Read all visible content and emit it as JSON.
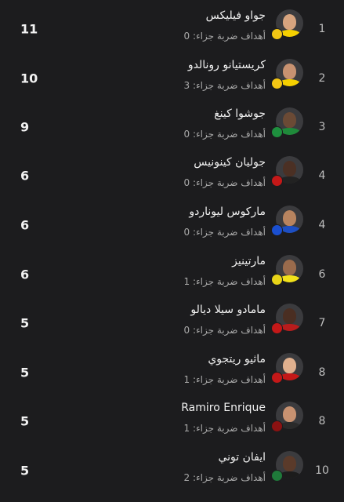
{
  "pen_label": "أهداف ضربة جزاء:",
  "colors": {
    "background": "#1c1c1e",
    "text_primary": "#f0f0f0",
    "text_secondary": "#a9a9a9"
  },
  "players": [
    {
      "rank": "1",
      "name": "جواو فيليكس",
      "penalties": "0",
      "goals": "11",
      "skin": "#d7a47f",
      "shirt": "#f5d000",
      "badge_color": "#f3c614",
      "badge_icon": "club-crest-icon"
    },
    {
      "rank": "2",
      "name": "كريستيانو رونالدو",
      "penalties": "3",
      "goals": "10",
      "skin": "#c89271",
      "shirt": "#f5d000",
      "badge_color": "#f3c614",
      "badge_icon": "club-crest-icon"
    },
    {
      "rank": "3",
      "name": "جوشوا كينغ",
      "penalties": "0",
      "goals": "9",
      "skin": "#6b4a35",
      "shirt": "#1f8a3a",
      "badge_color": "#1e8f3e",
      "badge_icon": "club-crest-icon"
    },
    {
      "rank": "4",
      "name": "جوليان كينونيس",
      "penalties": "0",
      "goals": "6",
      "skin": "#4b3024",
      "shirt": "#222222",
      "badge_color": "#c41818",
      "badge_icon": "club-crest-icon"
    },
    {
      "rank": "4",
      "name": "ماركوس ليوناردو",
      "penalties": "0",
      "goals": "6",
      "skin": "#b8845f",
      "shirt": "#1d4fc4",
      "badge_color": "#1a4fd0",
      "badge_icon": "club-crest-icon"
    },
    {
      "rank": "6",
      "name": "مارتينيز",
      "penalties": "1",
      "goals": "6",
      "skin": "#9a6b4c",
      "shirt": "#f2e21a",
      "badge_color": "#e8d418",
      "badge_icon": "club-crest-icon"
    },
    {
      "rank": "7",
      "name": "مامادو سيلا ديالو",
      "penalties": "0",
      "goals": "5",
      "skin": "#4a2e22",
      "shirt": "#b81c1c",
      "badge_color": "#c41818",
      "badge_icon": "club-crest-icon"
    },
    {
      "rank": "8",
      "name": "ماثيو ريتجوي",
      "penalties": "1",
      "goals": "5",
      "skin": "#e0b08e",
      "shirt": "#c41818",
      "badge_color": "#c41818",
      "badge_icon": "club-crest-icon"
    },
    {
      "rank": "8",
      "name": "Ramiro Enrique",
      "penalties": "1",
      "goals": "5",
      "skin": "#c89271",
      "shirt": "#2a2a2a",
      "badge_color": "#8b1212",
      "badge_icon": "club-crest-icon"
    },
    {
      "rank": "10",
      "name": "ايفان توني",
      "penalties": "2",
      "goals": "5",
      "skin": "#5a3a2a",
      "shirt": "#1c1c1c",
      "badge_color": "#1f7a3a",
      "badge_icon": "club-crest-icon"
    }
  ]
}
